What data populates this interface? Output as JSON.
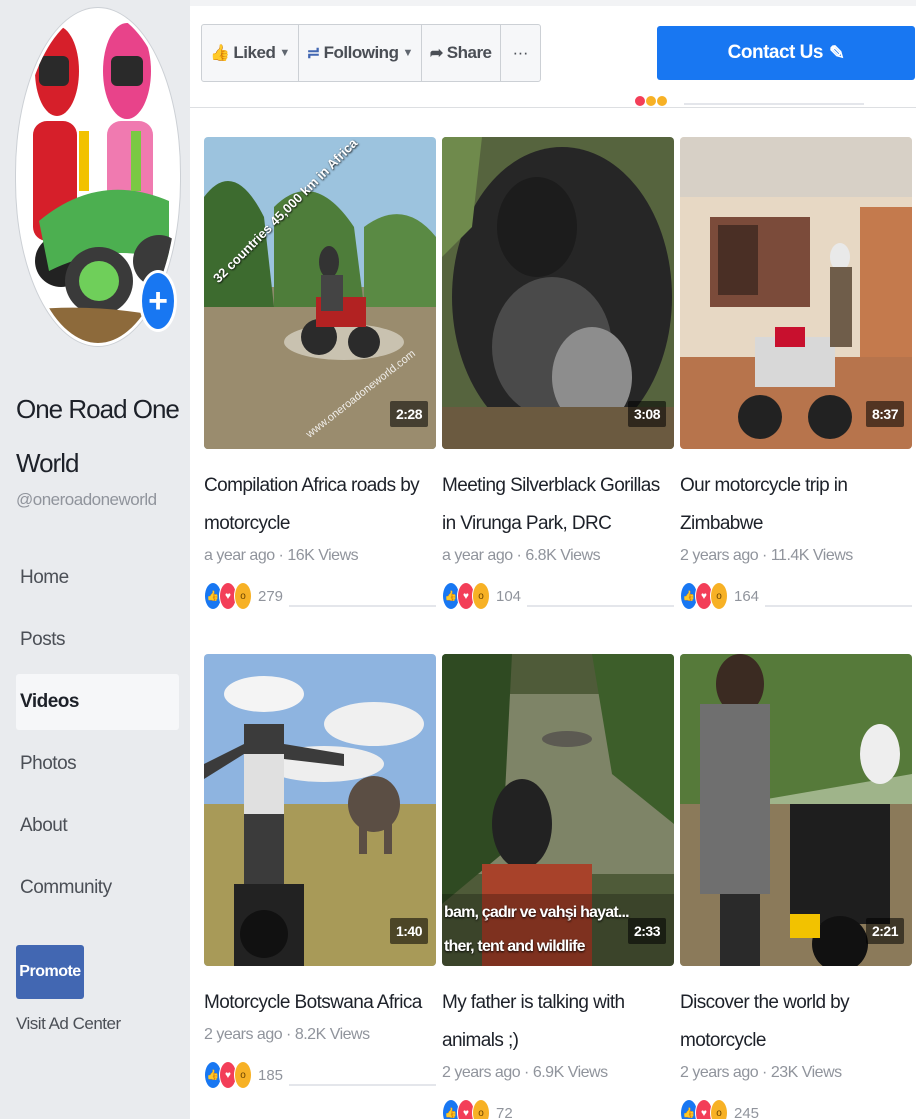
{
  "page": {
    "name": "One Road One World",
    "handle": "@oneroadoneworld"
  },
  "sidebar": {
    "items": [
      {
        "label": "Home"
      },
      {
        "label": "Posts"
      },
      {
        "label": "Videos",
        "active": true
      },
      {
        "label": "Photos"
      },
      {
        "label": "About"
      },
      {
        "label": "Community"
      }
    ],
    "promote_label": "Promote",
    "ad_center_label": "Visit Ad Center"
  },
  "toolbar": {
    "liked_label": "Liked",
    "following_label": "Following",
    "share_label": "Share",
    "more_label": "···",
    "contact_label": "Contact Us"
  },
  "videos": [
    {
      "title": "Compilation Africa roads by motorcycle",
      "meta": "a year ago · 16K Views",
      "duration": "2:28",
      "reactions": "279",
      "overlay_text": "32 countries 45,000 km in Africa",
      "watermark": "www.oneroadoneworld.com"
    },
    {
      "title": "Meeting Silverblack Gorillas in Virunga Park, DRC",
      "meta": "a year ago · 6.8K Views",
      "duration": "3:08",
      "reactions": "104"
    },
    {
      "title": "Our motorcycle trip in Zimbabwe",
      "meta": "2 years ago · 11.4K Views",
      "duration": "8:37",
      "reactions": "164"
    },
    {
      "title": "Motorcycle Botswana Africa",
      "meta": "2 years ago · 8.2K Views",
      "duration": "1:40",
      "reactions": "185"
    },
    {
      "title": "My father is talking with animals ;)",
      "meta": "2 years ago · 6.9K Views",
      "duration": "2:33",
      "reactions": "72",
      "subtitle_1": "bam, çadır ve vahşi hayat...",
      "subtitle_2": "ther, tent and wildlife"
    },
    {
      "title": "Discover the world by motorcycle",
      "meta": "2 years ago · 23K Views",
      "duration": "2:21",
      "reactions": "245"
    }
  ],
  "colors": {
    "brand_blue": "#1877f2",
    "promote_blue": "#4267b2",
    "like": "#1877f2",
    "love": "#f33e58",
    "wow": "#f7b125"
  },
  "icons": [
    "add-photo-icon",
    "like-icon",
    "rss-icon",
    "share-icon",
    "pencil-icon",
    "like-reaction-icon",
    "love-reaction-icon",
    "wow-reaction-icon"
  ]
}
